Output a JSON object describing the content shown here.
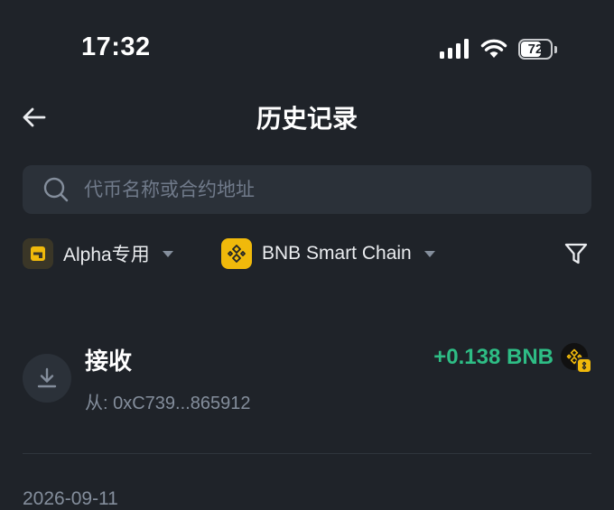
{
  "status_bar": {
    "time": "17:32",
    "battery_level": "72",
    "battery_fraction": 0.72
  },
  "nav": {
    "title": "历史记录",
    "back_icon": "arrow-left-icon"
  },
  "search": {
    "placeholder": "代币名称或合约地址",
    "value": ""
  },
  "filters": {
    "category_label": "Alpha专用",
    "chain_label": "BNB Smart Chain",
    "filter_icon": "funnel-icon"
  },
  "transactions": [
    {
      "type": "接收",
      "from": "从: 0xC739...865912",
      "amount": "+0.138 BNB",
      "icon": "download-icon"
    }
  ],
  "date_group": "2026-09-11",
  "colors": {
    "background": "#1f2329",
    "surface": "#2b3139",
    "positive": "#2ebd85",
    "accent": "#f0b90b",
    "muted": "#848e9c"
  }
}
